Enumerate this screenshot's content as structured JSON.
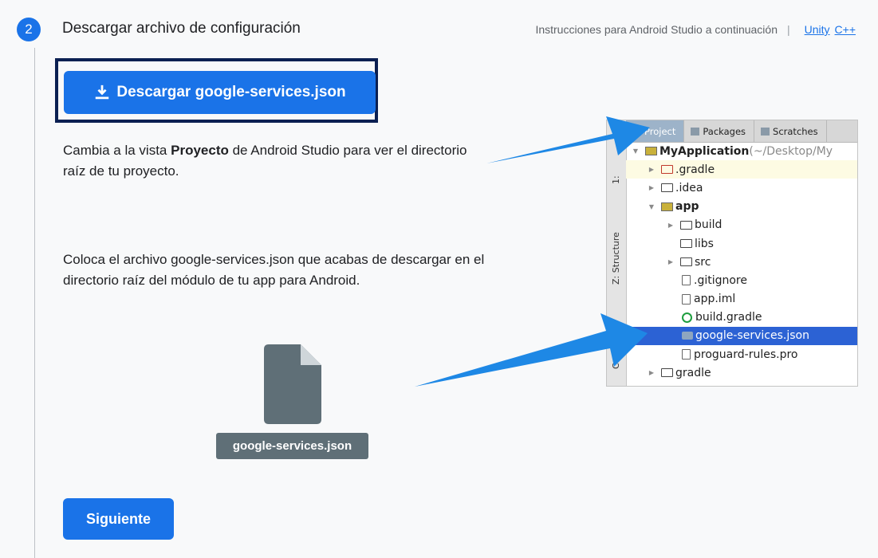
{
  "step": {
    "number": "2",
    "title": "Descargar archivo de configuración",
    "instructions_note": "Instrucciones para Android Studio a continuación",
    "separator": "|",
    "link_unity": "Unity",
    "link_cpp": "C++"
  },
  "download_button": {
    "label": "Descargar google-services.json",
    "icon": "download-icon"
  },
  "paragraph1": {
    "before": "Cambia a la vista ",
    "bold": "Proyecto",
    "after": " de Android Studio para ver el directorio raíz de tu proyecto."
  },
  "paragraph2": "Coloca el archivo google-services.json que acabas de descargar en el directorio raíz del módulo de tu app para Android.",
  "file_tile": {
    "label": "google-services.json",
    "icon": "file-icon"
  },
  "next_button": {
    "label": "Siguiente"
  },
  "ide": {
    "tabs": [
      "Project",
      "Packages",
      "Scratches"
    ],
    "side_labels": [
      "1:",
      "Z: Structure",
      "Captures"
    ],
    "tree": [
      {
        "label": "MyApplication",
        "suffix": " (~/Desktop/My",
        "icon": "module-folder-icon"
      },
      {
        "label": ".gradle",
        "icon": "folder-icon"
      },
      {
        "label": ".idea",
        "icon": "folder-icon"
      },
      {
        "label": "app",
        "icon": "module-folder-icon"
      },
      {
        "label": "build",
        "icon": "folder-icon"
      },
      {
        "label": "libs",
        "icon": "folder-icon"
      },
      {
        "label": "src",
        "icon": "folder-icon"
      },
      {
        "label": ".gitignore",
        "icon": "file-icon"
      },
      {
        "label": "app.iml",
        "icon": "iml-file-icon"
      },
      {
        "label": "build.gradle",
        "icon": "gradle-icon"
      },
      {
        "label": "google-services.json",
        "icon": "json-file-icon"
      },
      {
        "label": "proguard-rules.pro",
        "icon": "file-icon"
      },
      {
        "label": "gradle",
        "icon": "folder-icon"
      }
    ]
  },
  "colors": {
    "primary": "#1a73e8",
    "frame": "#0b2052",
    "file_tile": "#5f6f77",
    "arrow": "#1e88e5"
  }
}
